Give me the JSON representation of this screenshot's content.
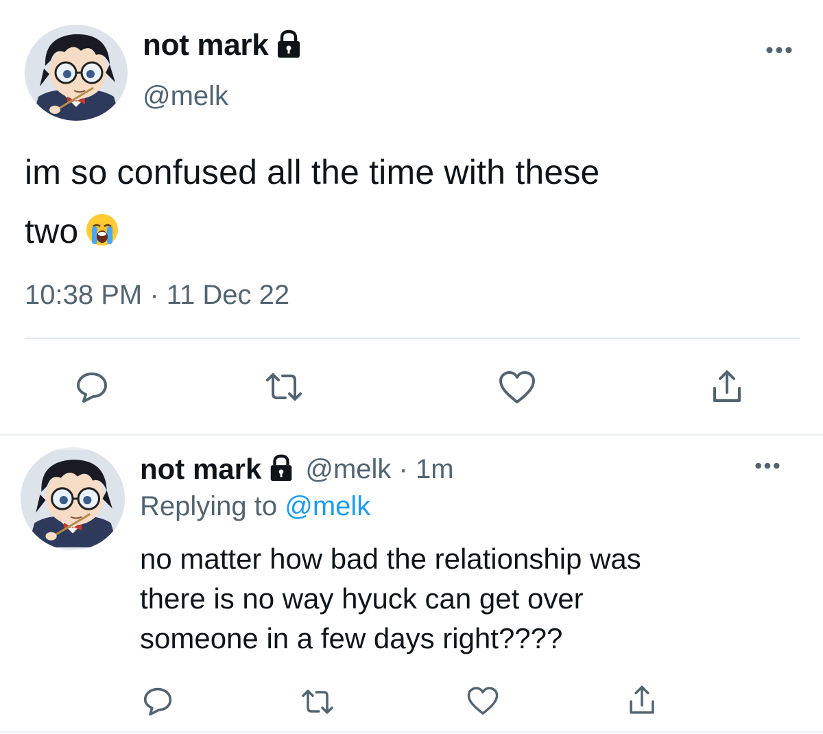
{
  "main_tweet": {
    "display_name": "not mark",
    "handle": "@melk",
    "text_line_1": "im so confused all the time with these",
    "text_line_2": "two",
    "emoji": "loudly-crying-face",
    "timestamp": "10:38 PM · 11 Dec 22",
    "icons": {
      "lock": "lock-icon",
      "more": "more-icon",
      "reply": "reply-icon",
      "retweet": "retweet-icon",
      "like": "heart-icon",
      "share": "share-icon"
    }
  },
  "reply_tweet": {
    "display_name": "not mark",
    "handle_time": "@melk · 1m",
    "replying_prefix": "Replying to",
    "replying_to": "@melk",
    "text_line_1": "no matter how bad the relationship was",
    "text_line_2": "there is no way hyuck can get over",
    "text_line_3": "someone in a few days right????"
  },
  "colors": {
    "text_primary": "#0f1419",
    "text_secondary": "#536471",
    "link": "#1d9bf0",
    "icon": "#536471",
    "divider": "#eff3f4"
  }
}
